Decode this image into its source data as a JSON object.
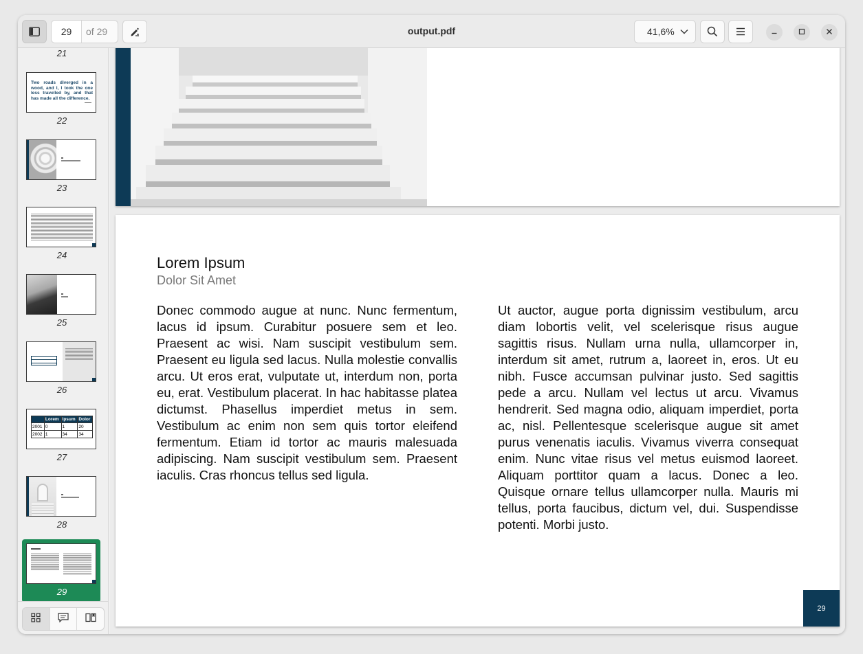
{
  "header": {
    "title": "output.pdf",
    "page_current": "29",
    "page_total": "of 29",
    "zoom": "41,6%"
  },
  "sidebar": {
    "thumbnails": [
      {
        "label": "21"
      },
      {
        "label": "22",
        "quote": "Two roads diverged in a wood, and I, I took the one less travelled by, and that has made all the difference."
      },
      {
        "label": "23"
      },
      {
        "label": "24"
      },
      {
        "label": "25"
      },
      {
        "label": "26"
      },
      {
        "label": "27",
        "table": {
          "headers": [
            "",
            "Lorem",
            "Ipsum",
            "Dolor"
          ],
          "rows": [
            [
              "2001",
              "0",
              "1",
              "20"
            ],
            [
              "2002",
              "1",
              "34",
              "34"
            ]
          ]
        }
      },
      {
        "label": "28"
      },
      {
        "label": "29"
      }
    ]
  },
  "page": {
    "title": "Lorem Ipsum",
    "subtitle": "Dolor Sit Amet",
    "col1": "Donec commodo augue at nunc. Nunc fermentum, lacus id ipsum. Curabitur posuere sem et leo. Praesent ac wisi. Nam suscipit vestibulum sem. Praesent eu ligula sed lacus. Nulla molestie convallis arcu. Ut eros erat, vulputate ut, interdum non, porta eu, erat. Vestibulum placerat. In hac habitasse platea dictumst. Phasellus imperdiet metus in sem. Vestibulum ac enim non sem quis tortor eleifend fermentum. Etiam id tortor ac mauris malesuada adipiscing. Nam suscipit vestibulum sem. Praesent iaculis. Cras rhoncus tellus sed ligula.",
    "col2": "Ut auctor, augue porta dignissim vestibulum, arcu diam lobortis velit, vel scelerisque risus augue sagittis risus. Nullam urna nulla, ullamcorper in, interdum sit amet, rutrum a, laoreet in, eros. Ut eu nibh. Fusce accumsan pulvinar justo. Sed sagittis pede a arcu. Nullam vel lectus ut arcu. Vivamus hendrerit. Sed magna odio, aliquam imperdiet, porta ac, nisl. Pellentesque scelerisque augue sit amet purus venenatis iaculis. Vivamus viverra consequat enim. Nunc vitae risus vel metus euismod laoreet. Aliquam porttitor quam a lacus. Donec a leo. Quisque ornare tellus ullamcorper nulla. Mauris mi tellus, porta faucibus, dictum vel, dui. Suspendisse potenti. Morbi justo.",
    "page_number": "29"
  },
  "colors": {
    "accent": "#0d3a56",
    "selection": "#1d8a56"
  },
  "icons": {
    "sidebar_toggle": "sidebar-icon",
    "annotate": "pen-icon",
    "zoom_dropdown": "chevron-down-icon",
    "search": "search-icon",
    "menu": "hamburger-menu-icon",
    "minimize": "minimize-icon",
    "maximize": "maximize-icon",
    "close": "close-icon",
    "thumbnails": "grid-icon",
    "annotations": "comment-icon",
    "bookmarks": "book-icon"
  }
}
